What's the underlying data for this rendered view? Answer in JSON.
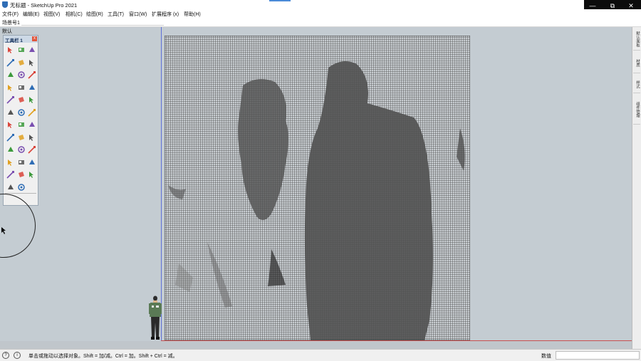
{
  "window": {
    "title": "无标题 - SketchUp Pro 2021",
    "controls": {
      "minimize": "—",
      "maximize": "⧉",
      "close": "✕"
    }
  },
  "menu": {
    "items": [
      "文件(F)",
      "编辑(E)",
      "视图(V)",
      "相机(C)",
      "绘图(R)",
      "工具(T)",
      "窗口(W)",
      "扩展程序 (x)",
      "帮助(H)"
    ]
  },
  "scenes": {
    "label": "场景号1"
  },
  "viewport": {
    "tray_label": "默认",
    "toolbar": {
      "title": "工具栏 1",
      "close": "x",
      "icons": [
        "select-icon",
        "eraser-icon",
        "paint-bucket-icon",
        "lasso-icon",
        "rectangle-icon",
        "pencil-icon",
        "push-pull-icon",
        "move-icon",
        "scale-icon",
        "line-icon",
        "arc-icon",
        "follow-me-icon",
        "shield-icon",
        "globe-icon",
        "paint-bucket-2-icon",
        "circle-shape-icon",
        "polygon-icon",
        "3d-text-icon",
        "axes-icon",
        "tape-measure-icon",
        "section-icon",
        "orbit-icon",
        "pan-icon",
        "zoom-icon",
        "sandbox-icon",
        "terrain-icon",
        "drape-icon",
        "cube-add-icon",
        "cube-move-icon",
        "cube-stack-icon",
        "component-icon",
        "layer-icon",
        "group-icon",
        "zz-icon",
        "paint-brush-icon"
      ]
    },
    "colors": {
      "background": "#c4ccd2",
      "blue_axis": "#5d6fd8",
      "red_axis": "#c85050"
    }
  },
  "tray": {
    "tabs": [
      "默认面板",
      "材质",
      "样式",
      "组件管理"
    ]
  },
  "status": {
    "text": "单击或拖动以选择对象。Shift = 加/减。Ctrl = 加。Shift + Ctrl = 减。",
    "measurements_label": "数值",
    "measurements_value": ""
  }
}
